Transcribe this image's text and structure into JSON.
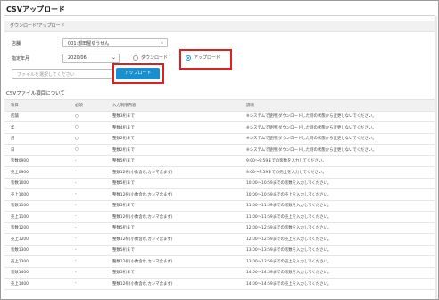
{
  "page": {
    "title": "CSVアップロード"
  },
  "section": {
    "title": "ダウンロード/アップロード"
  },
  "form": {
    "store_label": "店舗",
    "store_value": "001:部田屋ゆうせん",
    "month_label": "指定年月",
    "month_value": "2020/06",
    "radio_download": "ダウンロード",
    "radio_upload": "アップロード",
    "file_placeholder": "ファイルを選択してください",
    "upload_button": "アップロード"
  },
  "csv_info": {
    "title": "CSVファイル項目について",
    "headers": [
      "項目",
      "必須",
      "入力制限内容",
      "説明"
    ],
    "rows": [
      [
        "店舗",
        "○",
        "整数3桁まで",
        "※システムで使用(ダウンロードした時の状態から変更しないでください。"
      ],
      [
        "年",
        "○",
        "整数4桁まで",
        "※システムで使用(ダウンロードした時の状態から変更しないでください。"
      ],
      [
        "月",
        "○",
        "整数2桁まで",
        "※システムで使用(ダウンロードした時の状態から変更しないでください。"
      ],
      [
        "日",
        "○",
        "整数2桁まで",
        "※システムで使用(ダウンロードした時の状態から変更しないでください。"
      ],
      [
        "客数0900",
        "-",
        "整数5桁まで",
        "9:00〜9:59までの客数を入力してください。"
      ],
      [
        "売上0900",
        "-",
        "整数12桁(小数含む,カンマ含まず)",
        "9:00〜9:59までの売上を入力してください。"
      ],
      [
        "客数1000",
        "-",
        "整数5桁まで",
        "10:00〜10:59までの客数を入力してください。"
      ],
      [
        "売上1000",
        "-",
        "整数12桁(小数含む,カンマ含まず)",
        "10:00〜10:59までの売上を入力してください。"
      ],
      [
        "客数1100",
        "-",
        "整数5桁まで",
        "11:00〜11:59までの客数を入力してください。"
      ],
      [
        "売上1100",
        "-",
        "整数12桁(小数含む,カンマ含まず)",
        "11:00〜11:59までの売上を入力してください。"
      ],
      [
        "客数1200",
        "-",
        "整数5桁まで",
        "12:00〜12:59までの客数を入力してください。"
      ],
      [
        "売上1200",
        "-",
        "整数12桁(小数含む,カンマ含まず)",
        "12:00〜12:59までの売上を入力してください。"
      ],
      [
        "客数1300",
        "-",
        "整数5桁まで",
        "13:00〜13:59までの客数を入力してください。"
      ],
      [
        "売上1300",
        "-",
        "整数12桁(小数含む,カンマ含まず)",
        "13:00〜13:59までの売上を入力してください。"
      ],
      [
        "客数1400",
        "-",
        "整数5桁まで",
        "14:00〜14:59までの客数を入力してください。"
      ],
      [
        "売上1400",
        "-",
        "整数12桁(小数含む,カンマ含まず)",
        "14:00〜14:59までの売上を入力してください。"
      ]
    ]
  },
  "icons": {
    "store_select": "chevron-down-icon",
    "month_select": "chevron-down-icon"
  },
  "colors": {
    "primary": "#1a8fd0",
    "highlight": "#e02020"
  }
}
